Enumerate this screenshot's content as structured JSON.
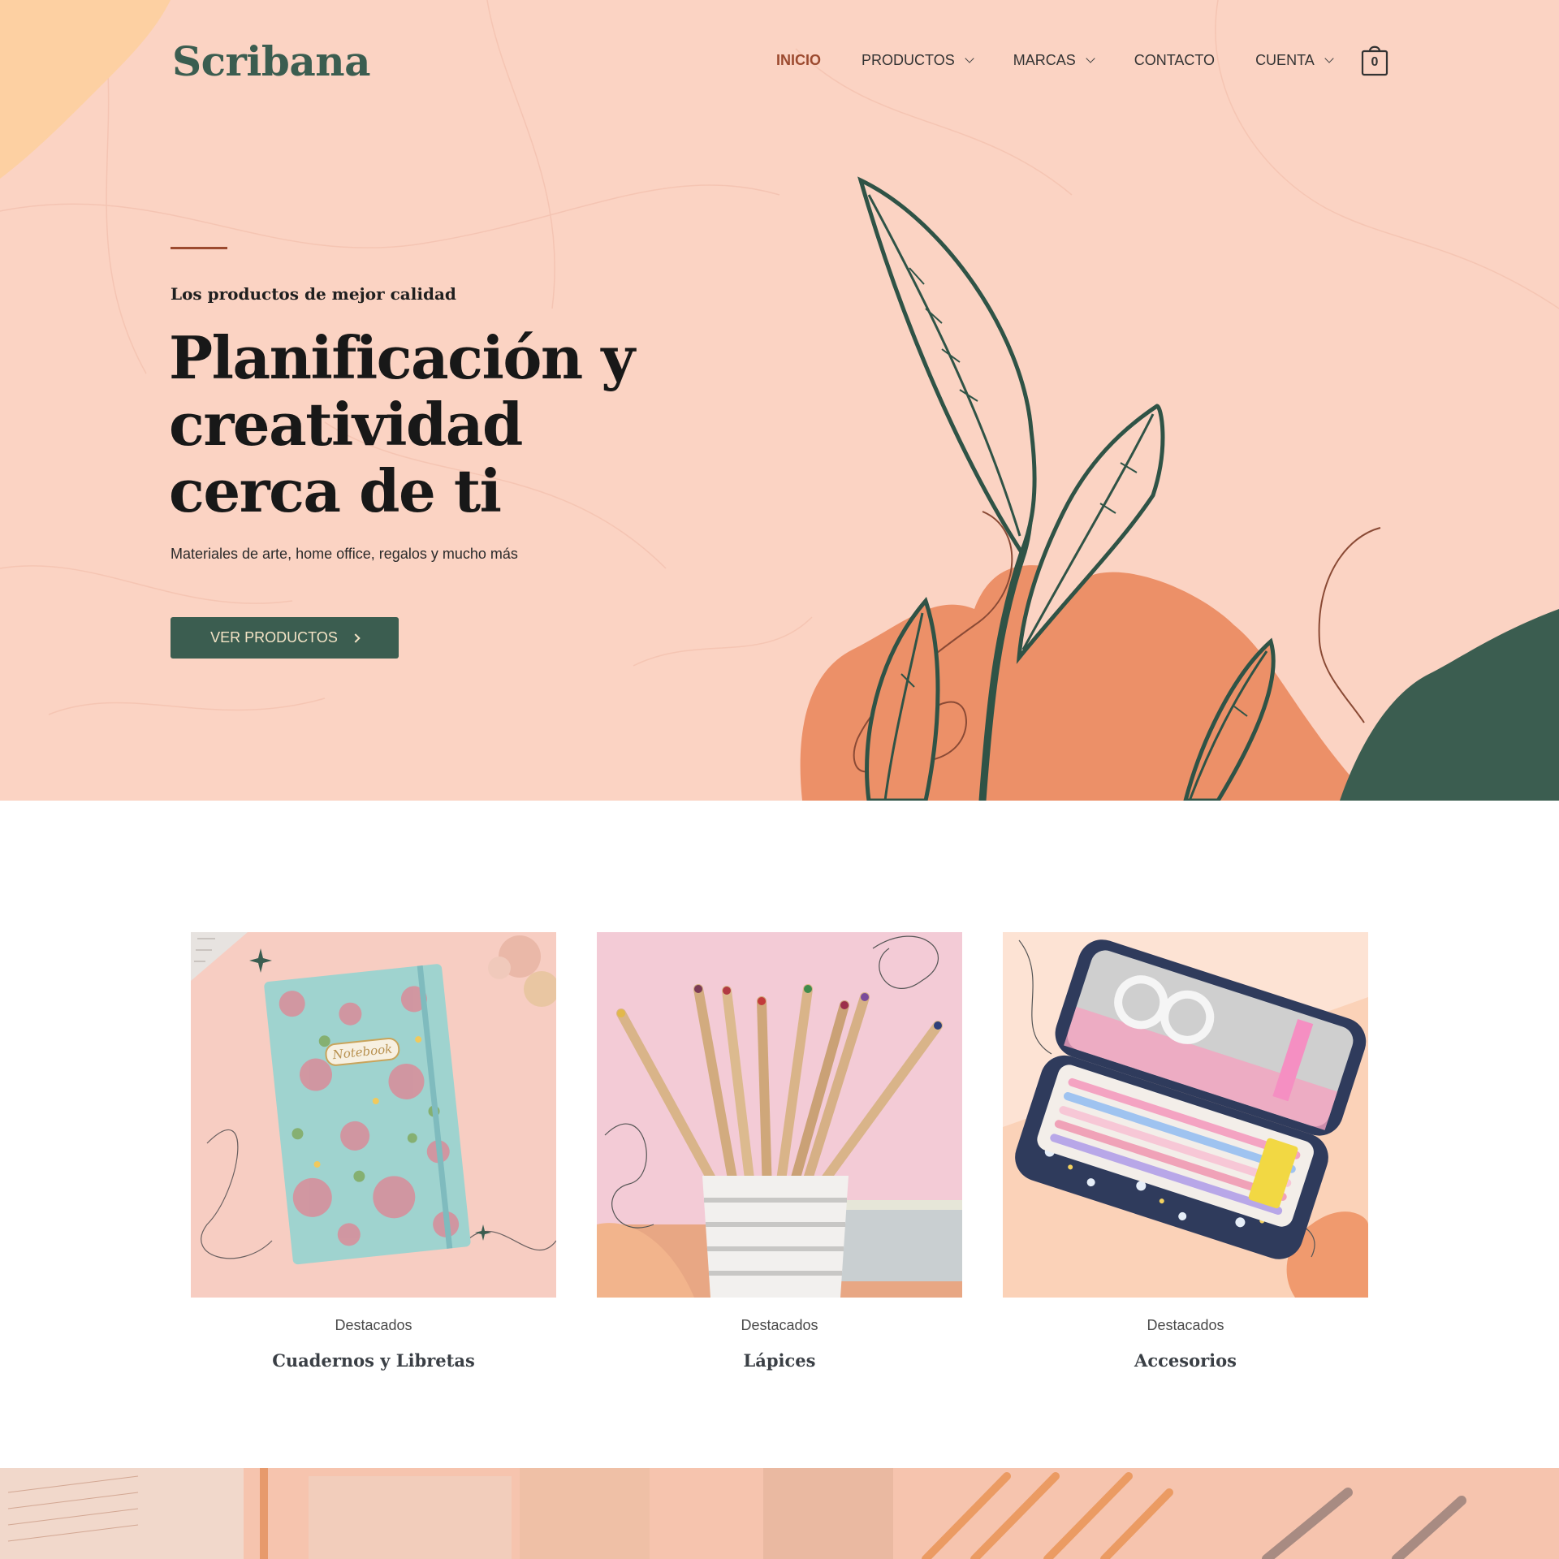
{
  "header": {
    "logo": "Scribana",
    "nav": [
      {
        "label": "INICIO",
        "active": true,
        "dropdown": false
      },
      {
        "label": "PRODUCTOS",
        "active": false,
        "dropdown": true
      },
      {
        "label": "MARCAS",
        "active": false,
        "dropdown": true
      },
      {
        "label": "CONTACTO",
        "active": false,
        "dropdown": false
      },
      {
        "label": "CUENTA",
        "active": false,
        "dropdown": true
      }
    ],
    "cart_count": "0"
  },
  "hero": {
    "eyebrow": "Los productos de mejor calidad",
    "title": "Planificación y creatividad cerca de ti",
    "subtitle": "Materiales de arte, home office, regalos y mucho más",
    "cta_label": "VER PRODUCTOS"
  },
  "categories": [
    {
      "kicker": "Destacados",
      "title": "Cuadernos y Libretas",
      "image_icon": "floral-notebook-image"
    },
    {
      "kicker": "Destacados",
      "title": "Lápices",
      "image_icon": "colored-pencils-image"
    },
    {
      "kicker": "Destacados",
      "title": "Accesorios",
      "image_icon": "pencil-case-image"
    }
  ],
  "colors": {
    "brand_green": "#3b5d50",
    "accent_rust": "#9c4a2f",
    "hero_bg": "#fbd3c3",
    "orange_blob": "#ec9068",
    "button_text": "#f4e4c6"
  }
}
